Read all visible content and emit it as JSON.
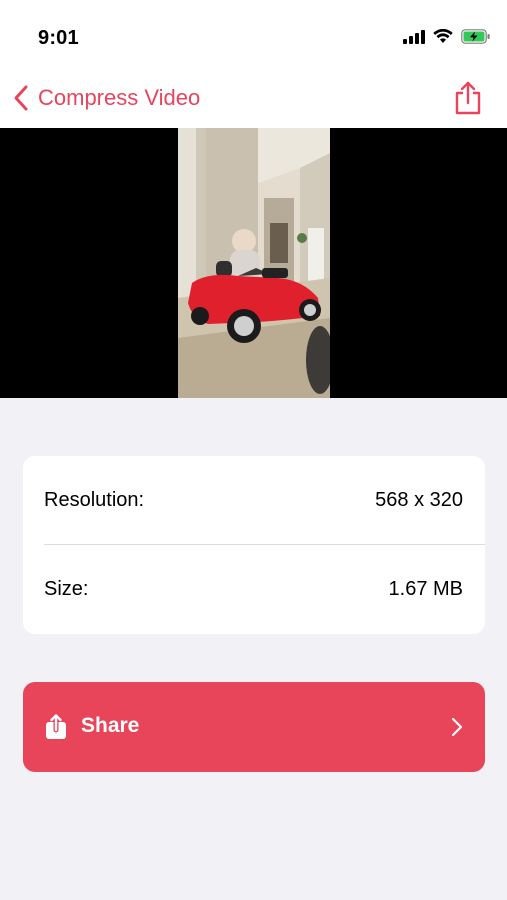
{
  "status_bar": {
    "time": "9:01",
    "icons": [
      "cellular-signal-icon",
      "wifi-icon",
      "battery-charging-icon"
    ]
  },
  "nav": {
    "back_icon": "chevron-left-icon",
    "title": "Compress Video",
    "action_icon": "share-icon"
  },
  "video": {
    "description_icon": "video-preview"
  },
  "info": {
    "rows": [
      {
        "label": "Resolution:",
        "value": "568 x 320"
      },
      {
        "label": "Size:",
        "value": "1.67 MB"
      }
    ]
  },
  "share_button": {
    "label": "Share",
    "icon": "share-icon",
    "trailing_icon": "chevron-right-icon"
  },
  "colors": {
    "accent": "#e8455d",
    "button_bg": "#e8445a",
    "page_bg": "#f2f1f6",
    "card_bg": "#ffffff"
  }
}
